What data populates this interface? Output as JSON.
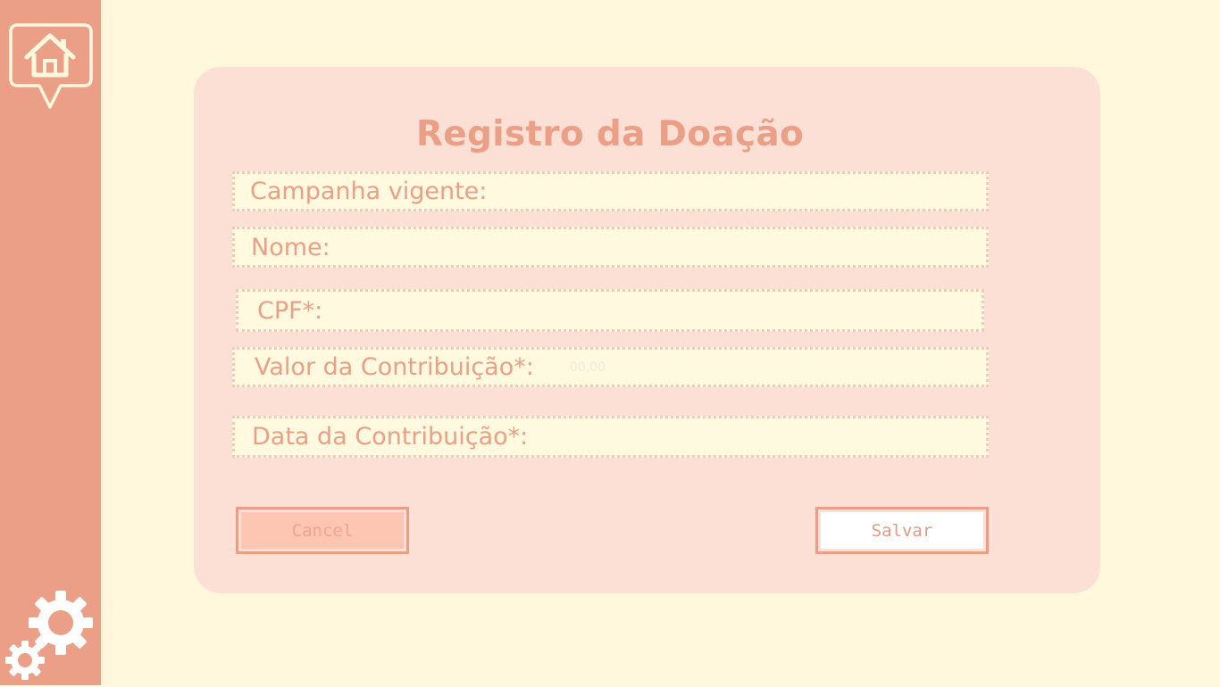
{
  "sidebar": {
    "home_icon": "home-icon",
    "settings_icon": "gears-icon"
  },
  "form": {
    "title": "Registro da Doação",
    "fields": [
      {
        "label": "Campanha vigente:",
        "value": "",
        "placeholder": ""
      },
      {
        "label": "Nome:",
        "value": "",
        "placeholder": ""
      },
      {
        "label": "CPF*:",
        "value": "",
        "placeholder": ""
      },
      {
        "label": "Valor da Contribuição*:",
        "value": "",
        "placeholder": "00,00"
      },
      {
        "label": "Data da Contribuição*:",
        "value": "",
        "placeholder": ""
      }
    ],
    "cancel_label": "Cancel",
    "save_label": "Salvar"
  },
  "colors": {
    "background": "#fff8dd",
    "sidebar": "#eb9f86",
    "card": "#fde0d5",
    "field": "#fffadf",
    "accent": "#eb9f86"
  }
}
